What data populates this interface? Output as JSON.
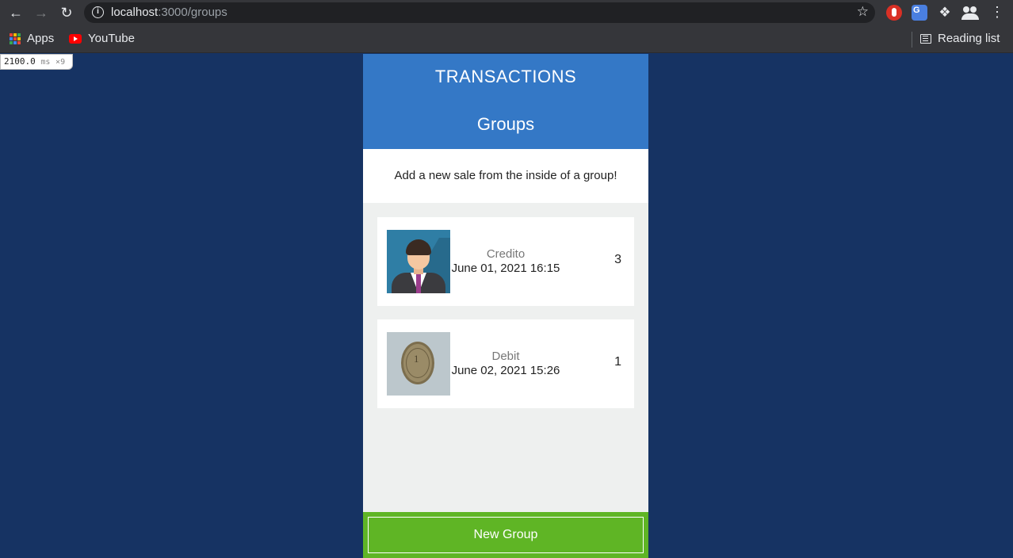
{
  "browser": {
    "url_host": "localhost",
    "url_path": ":3000/groups",
    "bookmarks": [
      {
        "label": "Apps"
      },
      {
        "label": "YouTube"
      }
    ],
    "reading_list_label": "Reading list"
  },
  "perf": {
    "value": "2100.0",
    "unit": "ms",
    "multiplier": "×9"
  },
  "app": {
    "title": "TRANSACTIONS",
    "page_title": "Groups",
    "hint": "Add a new sale from the inside of a group!",
    "groups": [
      {
        "name": "Credito",
        "date": "June 01, 2021 16:15",
        "count": "3",
        "image": "avatar-icon"
      },
      {
        "name": "Debit",
        "date": "June 02, 2021 15:26",
        "count": "1",
        "image": "coin-icon"
      }
    ],
    "new_group_label": "New Group"
  },
  "colors": {
    "page_background": "#163363",
    "header": "#3478c6",
    "new_group_bar": "#5fb525"
  }
}
